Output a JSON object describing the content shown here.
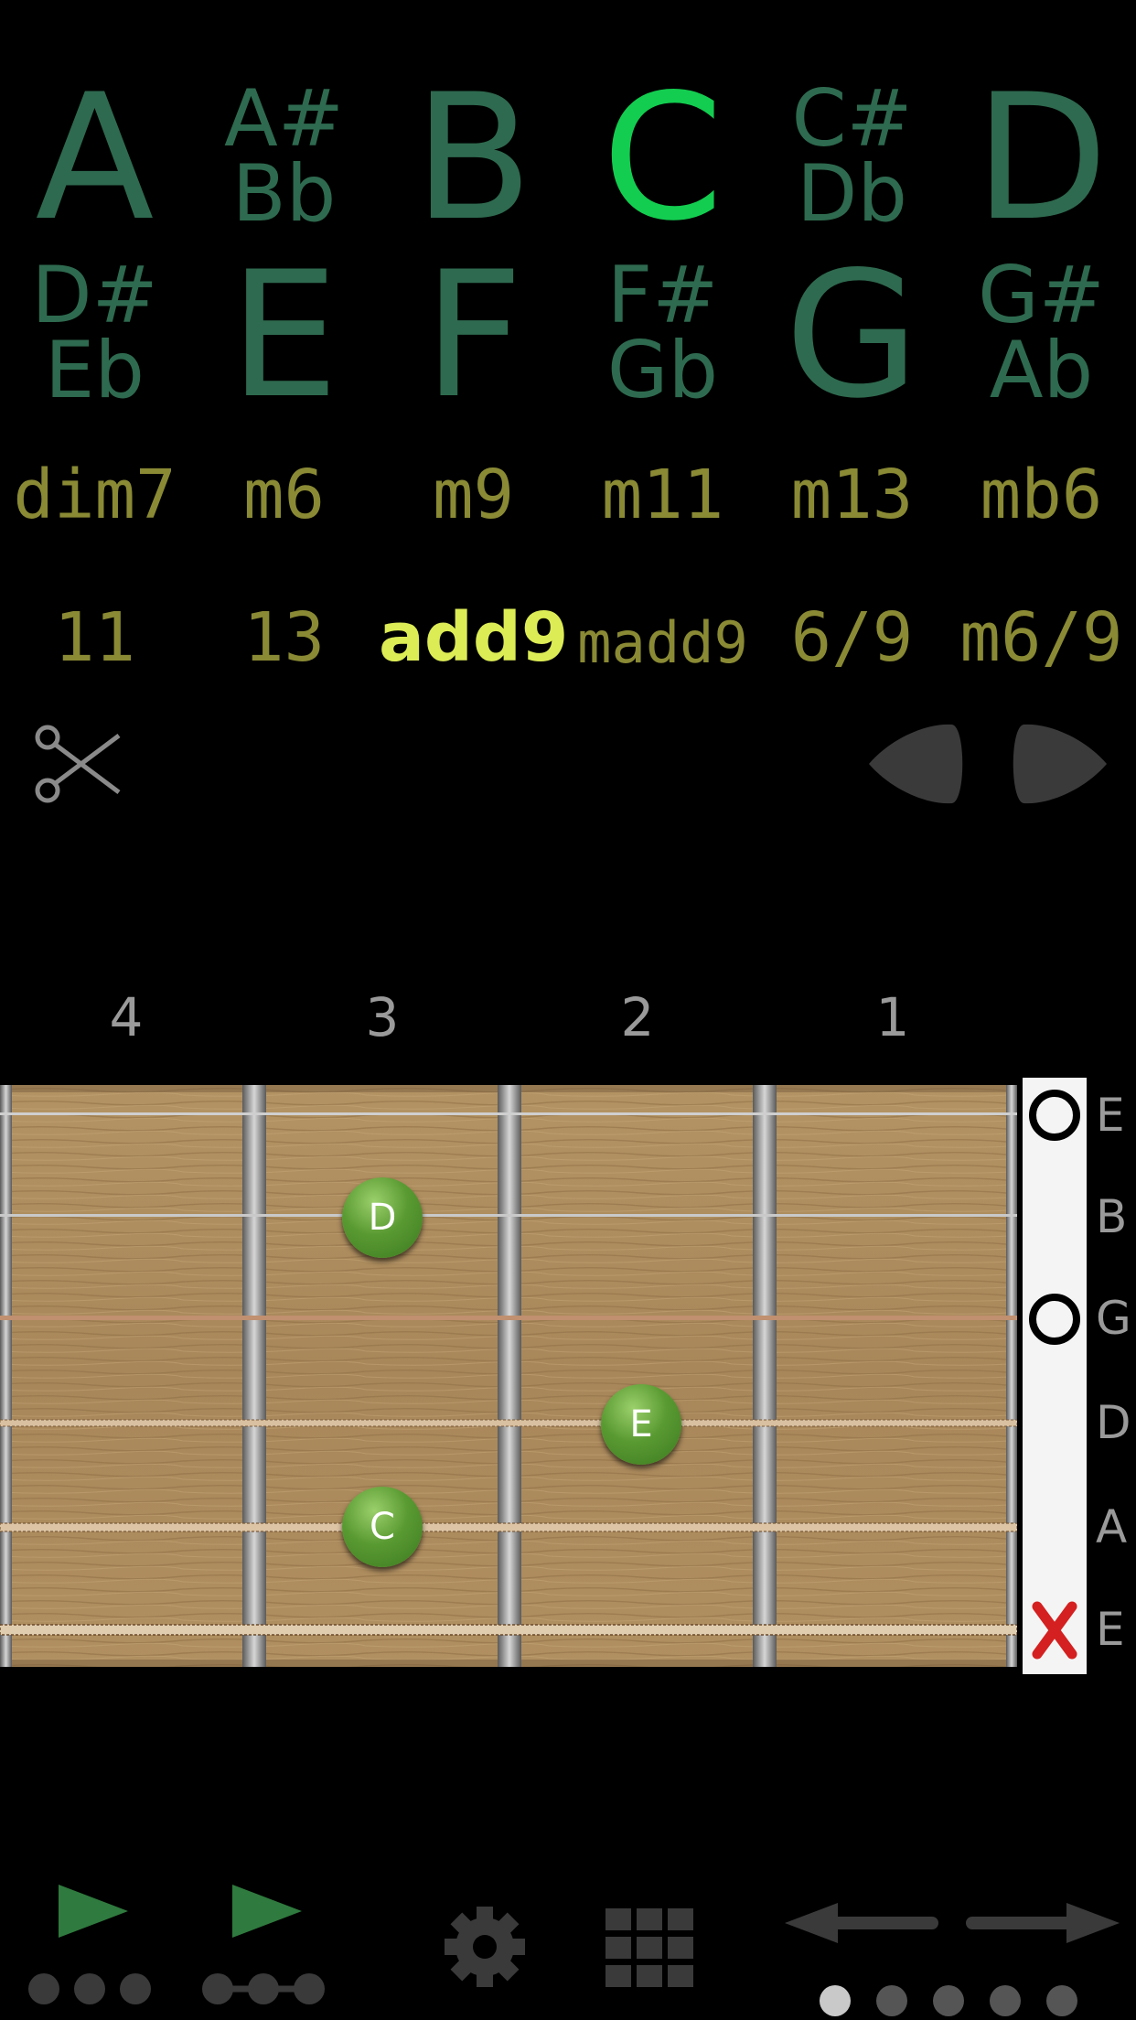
{
  "roots": {
    "row1": [
      {
        "lines": [
          "A"
        ]
      },
      {
        "lines": [
          "A#",
          "Bb"
        ]
      },
      {
        "lines": [
          "B"
        ]
      },
      {
        "lines": [
          "C"
        ],
        "selected": true
      },
      {
        "lines": [
          "C#",
          "Db"
        ]
      },
      {
        "lines": [
          "D"
        ]
      }
    ],
    "row2": [
      {
        "lines": [
          "D#",
          "Eb"
        ]
      },
      {
        "lines": [
          "E"
        ]
      },
      {
        "lines": [
          "F"
        ]
      },
      {
        "lines": [
          "F#",
          "Gb"
        ]
      },
      {
        "lines": [
          "G"
        ]
      },
      {
        "lines": [
          "G#",
          "Ab"
        ]
      }
    ]
  },
  "chord_types": {
    "row1": [
      "dim7",
      "m6",
      "m9",
      "m11",
      "m13",
      "mb6"
    ],
    "row2": [
      "11",
      "13",
      "add9",
      "madd9",
      "6/9",
      "m6/9"
    ],
    "selected": "add9"
  },
  "fret_numbers": [
    "4",
    "3",
    "2",
    "1"
  ],
  "string_labels": [
    "E",
    "B",
    "G",
    "D",
    "A",
    "E"
  ],
  "open_markers": [
    {
      "string": "E",
      "marker": "open"
    },
    {
      "string": "G",
      "marker": "open"
    },
    {
      "string": "E",
      "marker": "muted"
    }
  ],
  "notes": [
    {
      "label": "D",
      "string": "B",
      "fret": 3
    },
    {
      "label": "E",
      "string": "D",
      "fret": 2
    },
    {
      "label": "C",
      "string": "A",
      "fret": 3
    }
  ],
  "icons": {
    "scissors": "scissors-icon",
    "prev_pick": "guitar-pick-left-icon",
    "next_pick": "guitar-pick-right-icon",
    "play_strum": "play-strum-icon",
    "play_arpeggio": "play-arpeggio-icon",
    "settings": "gear-icon",
    "grid": "grid-icon",
    "arrow_left": "arrow-left-icon",
    "arrow_right": "arrow-right-icon"
  },
  "pager": {
    "count": 5,
    "active": 1
  },
  "colors": {
    "root_inactive": "#2e6a4f",
    "root_selected": "#13cd50",
    "chord_type": "#8a8a35",
    "chord_type_selected": "#dcec55",
    "note_dot": "#5a9a32",
    "muted_x": "#d42020"
  }
}
